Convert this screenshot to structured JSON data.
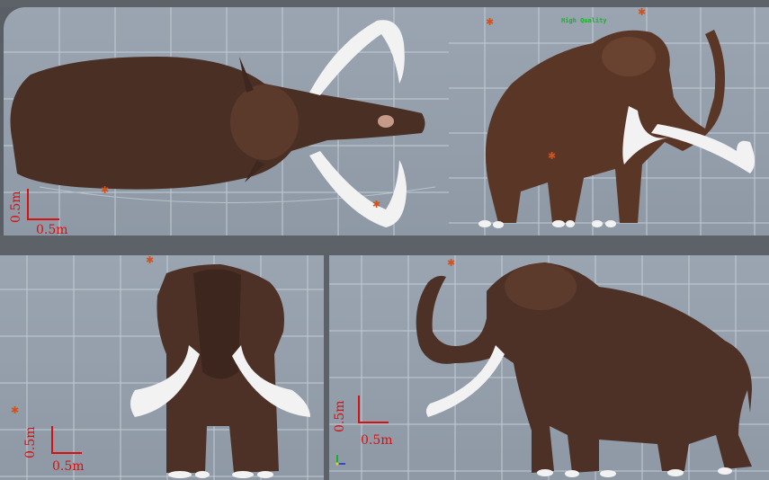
{
  "viewports": {
    "top": {
      "scale_label": "0.5m",
      "scale_label_vertical": "0.5m"
    },
    "perspective": {
      "quality_label": "High Quality"
    },
    "front": {
      "scale_label": "0.5m",
      "scale_label_vertical": "0.5m"
    },
    "side": {
      "scale_label": "0.5m",
      "scale_label_vertical": "0.5m"
    }
  },
  "colors": {
    "viewport_bg": "#9aa5b1",
    "grid_line": "#c8d0d8",
    "frame": "#5d6269",
    "scale_marker": "#d81010",
    "light_marker": "#d1521c",
    "mammoth_fur": "#4a2f24",
    "tusk": "#f2f2f2"
  },
  "icons": {
    "light_marker": "star-icon",
    "axis_gizmo": "axis-gizmo-icon"
  }
}
